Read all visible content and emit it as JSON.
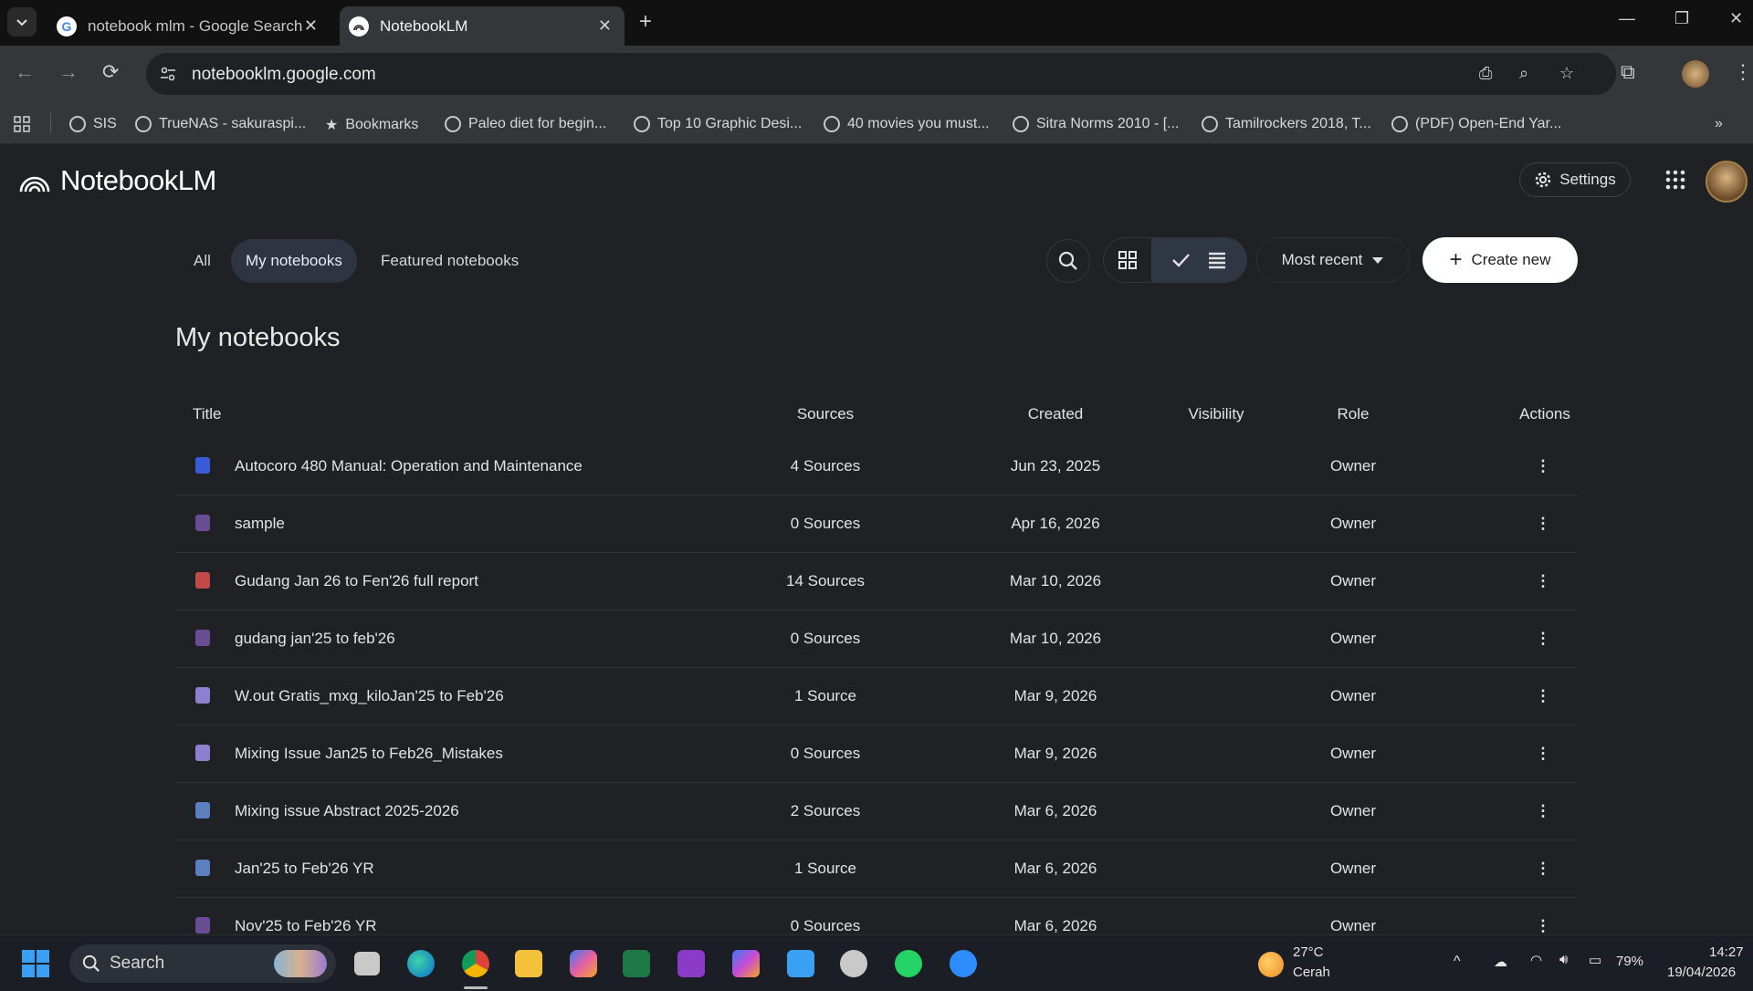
{
  "browser": {
    "tabs": [
      {
        "title": "notebook mlm - Google Search",
        "active": false
      },
      {
        "title": "NotebookLM",
        "active": true
      }
    ],
    "url": "notebooklm.google.com",
    "bookmarks": [
      "SIS",
      "TrueNAS - sakuraspi...",
      "Bookmarks",
      "Paleo diet for begin...",
      "Top 10 Graphic Desi...",
      "40 movies you must...",
      "Sitra Norms 2010 - [...",
      "Tamilrockers 2018, T...",
      "(PDF) Open-End Yar..."
    ]
  },
  "app": {
    "name": "NotebookLM",
    "settings_label": "Settings",
    "filters": [
      "All",
      "My notebooks",
      "Featured notebooks"
    ],
    "active_filter": "My notebooks",
    "sort_label": "Most recent",
    "create_label": "Create new",
    "page_title": "My notebooks",
    "columns": [
      "Title",
      "Sources",
      "Created",
      "Visibility",
      "Role",
      "Actions"
    ],
    "notebooks": [
      {
        "title": "Autocoro 480 Manual: Operation and Maintenance",
        "sources": "4 Sources",
        "created": "Jun 23, 2025",
        "visibility": "",
        "role": "Owner",
        "icon_color": "#3a5bd9"
      },
      {
        "title": "sample",
        "sources": "0 Sources",
        "created": "Apr 16, 2026",
        "visibility": "",
        "role": "Owner",
        "icon_color": "#6a4c93"
      },
      {
        "title": "Gudang Jan 26 to Fen'26 full report",
        "sources": "14 Sources",
        "created": "Mar 10, 2026",
        "visibility": "",
        "role": "Owner",
        "icon_color": "#c04a4a"
      },
      {
        "title": "gudang jan'25 to feb'26",
        "sources": "0 Sources",
        "created": "Mar 10, 2026",
        "visibility": "",
        "role": "Owner",
        "icon_color": "#6a4c93"
      },
      {
        "title": "W.out Gratis_mxg_kiloJan'25 to Feb'26",
        "sources": "1 Source",
        "created": "Mar 9, 2026",
        "visibility": "",
        "role": "Owner",
        "icon_color": "#8f7fd0"
      },
      {
        "title": "Mixing Issue Jan25 to Feb26_Mistakes",
        "sources": "0 Sources",
        "created": "Mar 9, 2026",
        "visibility": "",
        "role": "Owner",
        "icon_color": "#8f7fd0"
      },
      {
        "title": "Mixing issue Abstract 2025-2026",
        "sources": "2 Sources",
        "created": "Mar 6, 2026",
        "visibility": "",
        "role": "Owner",
        "icon_color": "#5b7fbf"
      },
      {
        "title": "Jan'25 to Feb'26 YR",
        "sources": "1 Source",
        "created": "Mar 6, 2026",
        "visibility": "",
        "role": "Owner",
        "icon_color": "#5b7fbf"
      },
      {
        "title": "Nov'25 to Feb'26 YR",
        "sources": "0 Sources",
        "created": "Mar 6, 2026",
        "visibility": "",
        "role": "Owner",
        "icon_color": "#6a4c93"
      }
    ]
  },
  "taskbar": {
    "search_label": "Search",
    "weather_temp": "27°C",
    "weather_desc": "Cerah",
    "battery": "79%",
    "time": "14:27",
    "date": "19/04/2026"
  }
}
